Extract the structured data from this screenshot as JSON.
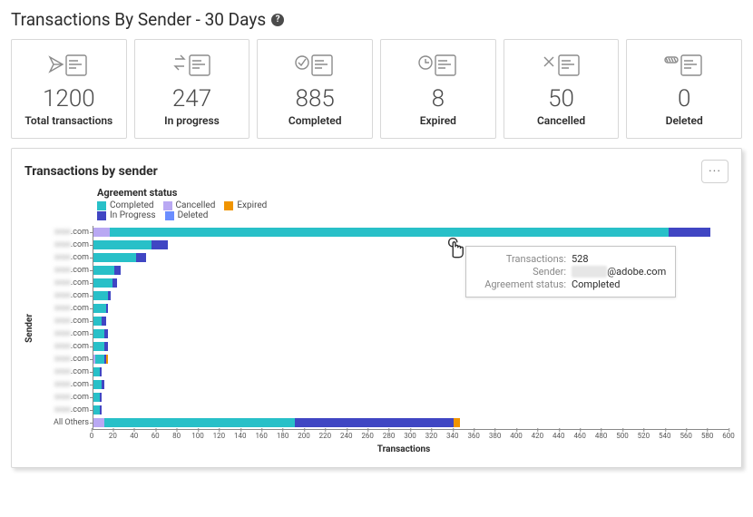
{
  "header": {
    "title": "Transactions By Sender - 30 Days",
    "help_glyph": "?"
  },
  "stats": [
    {
      "id": "total",
      "icon": "send-icon",
      "value": "1200",
      "label": "Total transactions"
    },
    {
      "id": "inprogress",
      "icon": "progress-icon",
      "value": "247",
      "label": "In progress"
    },
    {
      "id": "completed",
      "icon": "completed-icon",
      "value": "885",
      "label": "Completed"
    },
    {
      "id": "expired",
      "icon": "expired-icon",
      "value": "8",
      "label": "Expired"
    },
    {
      "id": "cancelled",
      "icon": "cancelled-icon",
      "value": "50",
      "label": "Cancelled"
    },
    {
      "id": "deleted",
      "icon": "deleted-icon",
      "value": "0",
      "label": "Deleted"
    }
  ],
  "chart": {
    "title": "Transactions by sender",
    "legend_title": "Agreement status",
    "legend": [
      {
        "key": "completed",
        "label": "Completed",
        "color": "#28c0c8"
      },
      {
        "key": "cancelled",
        "label": "Cancelled",
        "color": "#b9a8f3"
      },
      {
        "key": "expired",
        "label": "Expired",
        "color": "#f09400"
      },
      {
        "key": "inprogress",
        "label": "In Progress",
        "color": "#4046c3"
      },
      {
        "key": "deleted",
        "label": "Deleted",
        "color": "#6a8dff"
      }
    ],
    "y_axis_label": "Sender",
    "x_axis_label": "Transactions",
    "x_ticks": [
      0,
      20,
      40,
      60,
      80,
      100,
      120,
      140,
      160,
      180,
      200,
      220,
      240,
      260,
      280,
      300,
      320,
      340,
      360,
      380,
      400,
      420,
      440,
      460,
      480,
      500,
      520,
      540,
      560,
      580,
      600
    ],
    "more_menu_glyph": "···"
  },
  "tooltip": {
    "fields": {
      "transactions_label": "Transactions:",
      "transactions_value": "528",
      "sender_label": "Sender:",
      "sender_value": "@adobe.com",
      "status_label": "Agreement status:",
      "status_value": "Completed"
    }
  },
  "chart_data": {
    "type": "bar",
    "orientation": "horizontal",
    "stacked": true,
    "xlabel": "Transactions",
    "ylabel": "Sender",
    "xlim": [
      0,
      600
    ],
    "categories": [
      ".com",
      ".com",
      ".com",
      ".com",
      ".com",
      ".com",
      ".com",
      ".com",
      ".com",
      ".com",
      ".com",
      ".com",
      ".com",
      ".com",
      ".com",
      "All Others"
    ],
    "series": [
      {
        "name": "Completed",
        "color": "#28c0c8",
        "values": [
          528,
          55,
          40,
          20,
          18,
          14,
          12,
          8,
          10,
          10,
          8,
          6,
          8,
          6,
          6,
          180
        ]
      },
      {
        "name": "In Progress",
        "color": "#4046c3",
        "values": [
          40,
          15,
          10,
          6,
          4,
          2,
          2,
          4,
          4,
          4,
          2,
          2,
          2,
          2,
          2,
          150
        ]
      },
      {
        "name": "Cancelled",
        "color": "#b9a8f3",
        "values": [
          15,
          0,
          0,
          0,
          0,
          0,
          0,
          0,
          0,
          0,
          2,
          0,
          0,
          0,
          0,
          10
        ]
      },
      {
        "name": "Expired",
        "color": "#f09400",
        "values": [
          0,
          0,
          0,
          0,
          0,
          0,
          0,
          0,
          0,
          0,
          2,
          0,
          0,
          0,
          0,
          6
        ]
      },
      {
        "name": "Deleted",
        "color": "#6a8dff",
        "values": [
          0,
          0,
          0,
          0,
          0,
          0,
          0,
          0,
          0,
          0,
          0,
          0,
          0,
          0,
          0,
          0
        ]
      }
    ],
    "title": "Transactions by sender",
    "legend_title": "Agreement status"
  }
}
